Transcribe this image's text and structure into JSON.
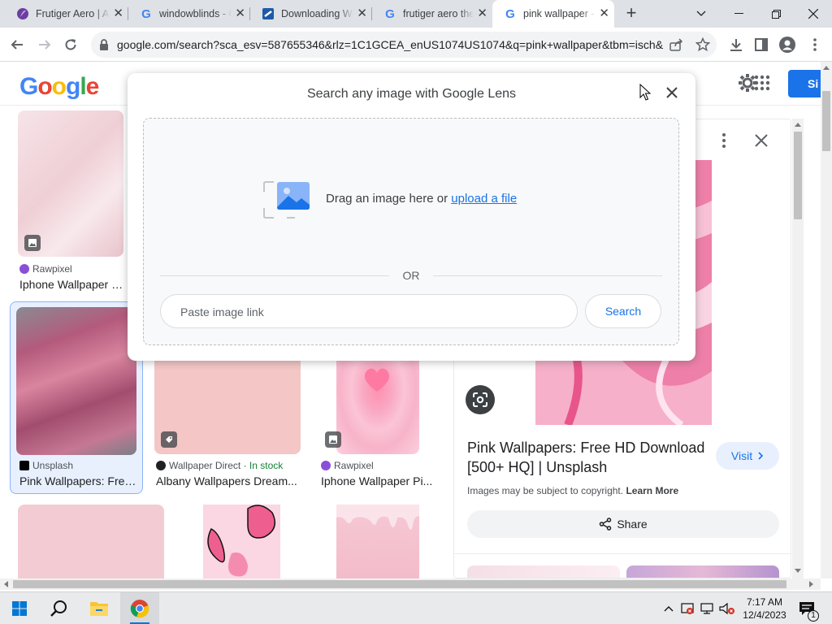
{
  "browser": {
    "tabs": [
      {
        "title": "Frutiger Aero | Aesthetics Wiki",
        "favicon": "purple-circle-icon"
      },
      {
        "title": "windowblinds - Google Search",
        "favicon": "google-icon"
      },
      {
        "title": "Downloading WindowBlinds",
        "favicon": "stardock-icon"
      },
      {
        "title": "frutiger aero theme - Google Search",
        "favicon": "google-icon"
      },
      {
        "title": "pink wallpaper - Google Search",
        "favicon": "google-icon"
      }
    ],
    "new_tab": "+",
    "url": "google.com/search?sca_esv=587655346&rlz=1C1GCEA_enUS1074US1074&q=pink+wallpaper&tbm=isch&..."
  },
  "google": {
    "logo_text": "Google",
    "signin": "Si"
  },
  "results": [
    {
      "source": "Rawpixel",
      "caption": "Iphone Wallpaper Pink",
      "color": "#f1d8dd"
    },
    {
      "source": "Unsplash",
      "caption": "Pink Wallpapers: Free ...",
      "color": "#b06a82"
    },
    {
      "source": "Wallpaper Direct",
      "stock": "In stock",
      "caption": "Albany Wallpapers Dream...",
      "color": "#f4c5c5"
    },
    {
      "source": "Rawpixel",
      "caption": "Iphone Wallpaper Pi...",
      "color": "#f8b8cc"
    }
  ],
  "panel": {
    "title": "Pink Wallpapers: Free HD Download [500+ HQ] | Unsplash",
    "visit": "Visit",
    "copyright": "Images may be subject to copyright.",
    "learn_more": "Learn More",
    "share": "Share"
  },
  "lens": {
    "title": "Search any image with Google Lens",
    "drag_text": "Drag an image here or",
    "upload_link": "upload a file",
    "or": "OR",
    "placeholder": "Paste image link",
    "search": "Search"
  },
  "taskbar": {
    "time": "7:17 AM",
    "date": "12/4/2023",
    "notifications": "1"
  }
}
